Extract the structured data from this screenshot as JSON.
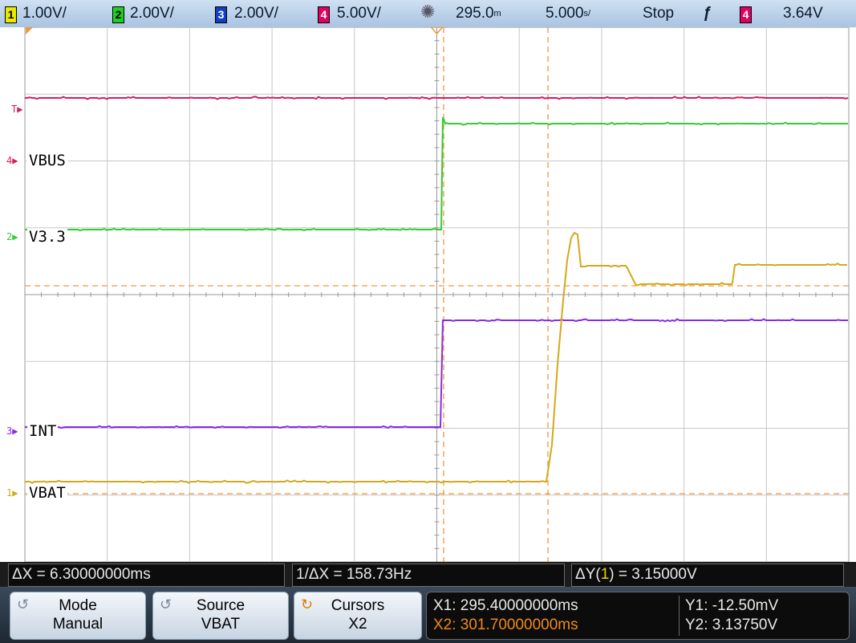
{
  "topbar": {
    "ch1": {
      "num": "1",
      "scale": "1.00V/"
    },
    "ch2": {
      "num": "2",
      "scale": "2.00V/"
    },
    "ch3": {
      "num": "3",
      "scale": "2.00V/"
    },
    "ch4": {
      "num": "4",
      "scale": "5.00V/"
    },
    "acquire_icon": "acquire-starburst-icon",
    "time_ref": "295.0",
    "time_ref_unit": "m",
    "timebase": "5.000",
    "timebase_unit": "s/",
    "run_state": "Stop",
    "trigger_slope_icon": "falling-edge-icon",
    "trigger_source": "4",
    "trigger_level": "3.64V"
  },
  "plot": {
    "markers": {
      "trigger": "T",
      "ch4": "4",
      "ch2": "2",
      "ch3": "3",
      "ch1": "1"
    },
    "labels": {
      "ch4": "VBUS",
      "ch2": "V3.3",
      "ch3": "INT",
      "ch1": "VBAT"
    }
  },
  "colors": {
    "ch1": "#d4a81a",
    "ch2": "#33cc33",
    "ch3": "#8a2be2",
    "ch4": "#d81b60",
    "cursor": "#f0963c",
    "grid": "#c8c8c8"
  },
  "measurements": {
    "delta_x": "ΔX = 6.30000000ms",
    "inv_delta_x": "1/ΔX = 158.73Hz",
    "delta_y_prefix": "ΔY(",
    "delta_y_ch": "1",
    "delta_y_suffix": ") = 3.15000V"
  },
  "softkeys": {
    "mode": {
      "line1": "Mode",
      "line2": "Manual"
    },
    "source": {
      "line1": "Source",
      "line2": "VBAT"
    },
    "cursors": {
      "line1": "Cursors",
      "line2": "X2"
    }
  },
  "cursor_panel": {
    "x1": "X1: 295.40000000ms",
    "x2": "X2: 301.70000000ms",
    "y1": "Y1: -12.50mV",
    "y2": "Y2: 3.13750V"
  }
}
